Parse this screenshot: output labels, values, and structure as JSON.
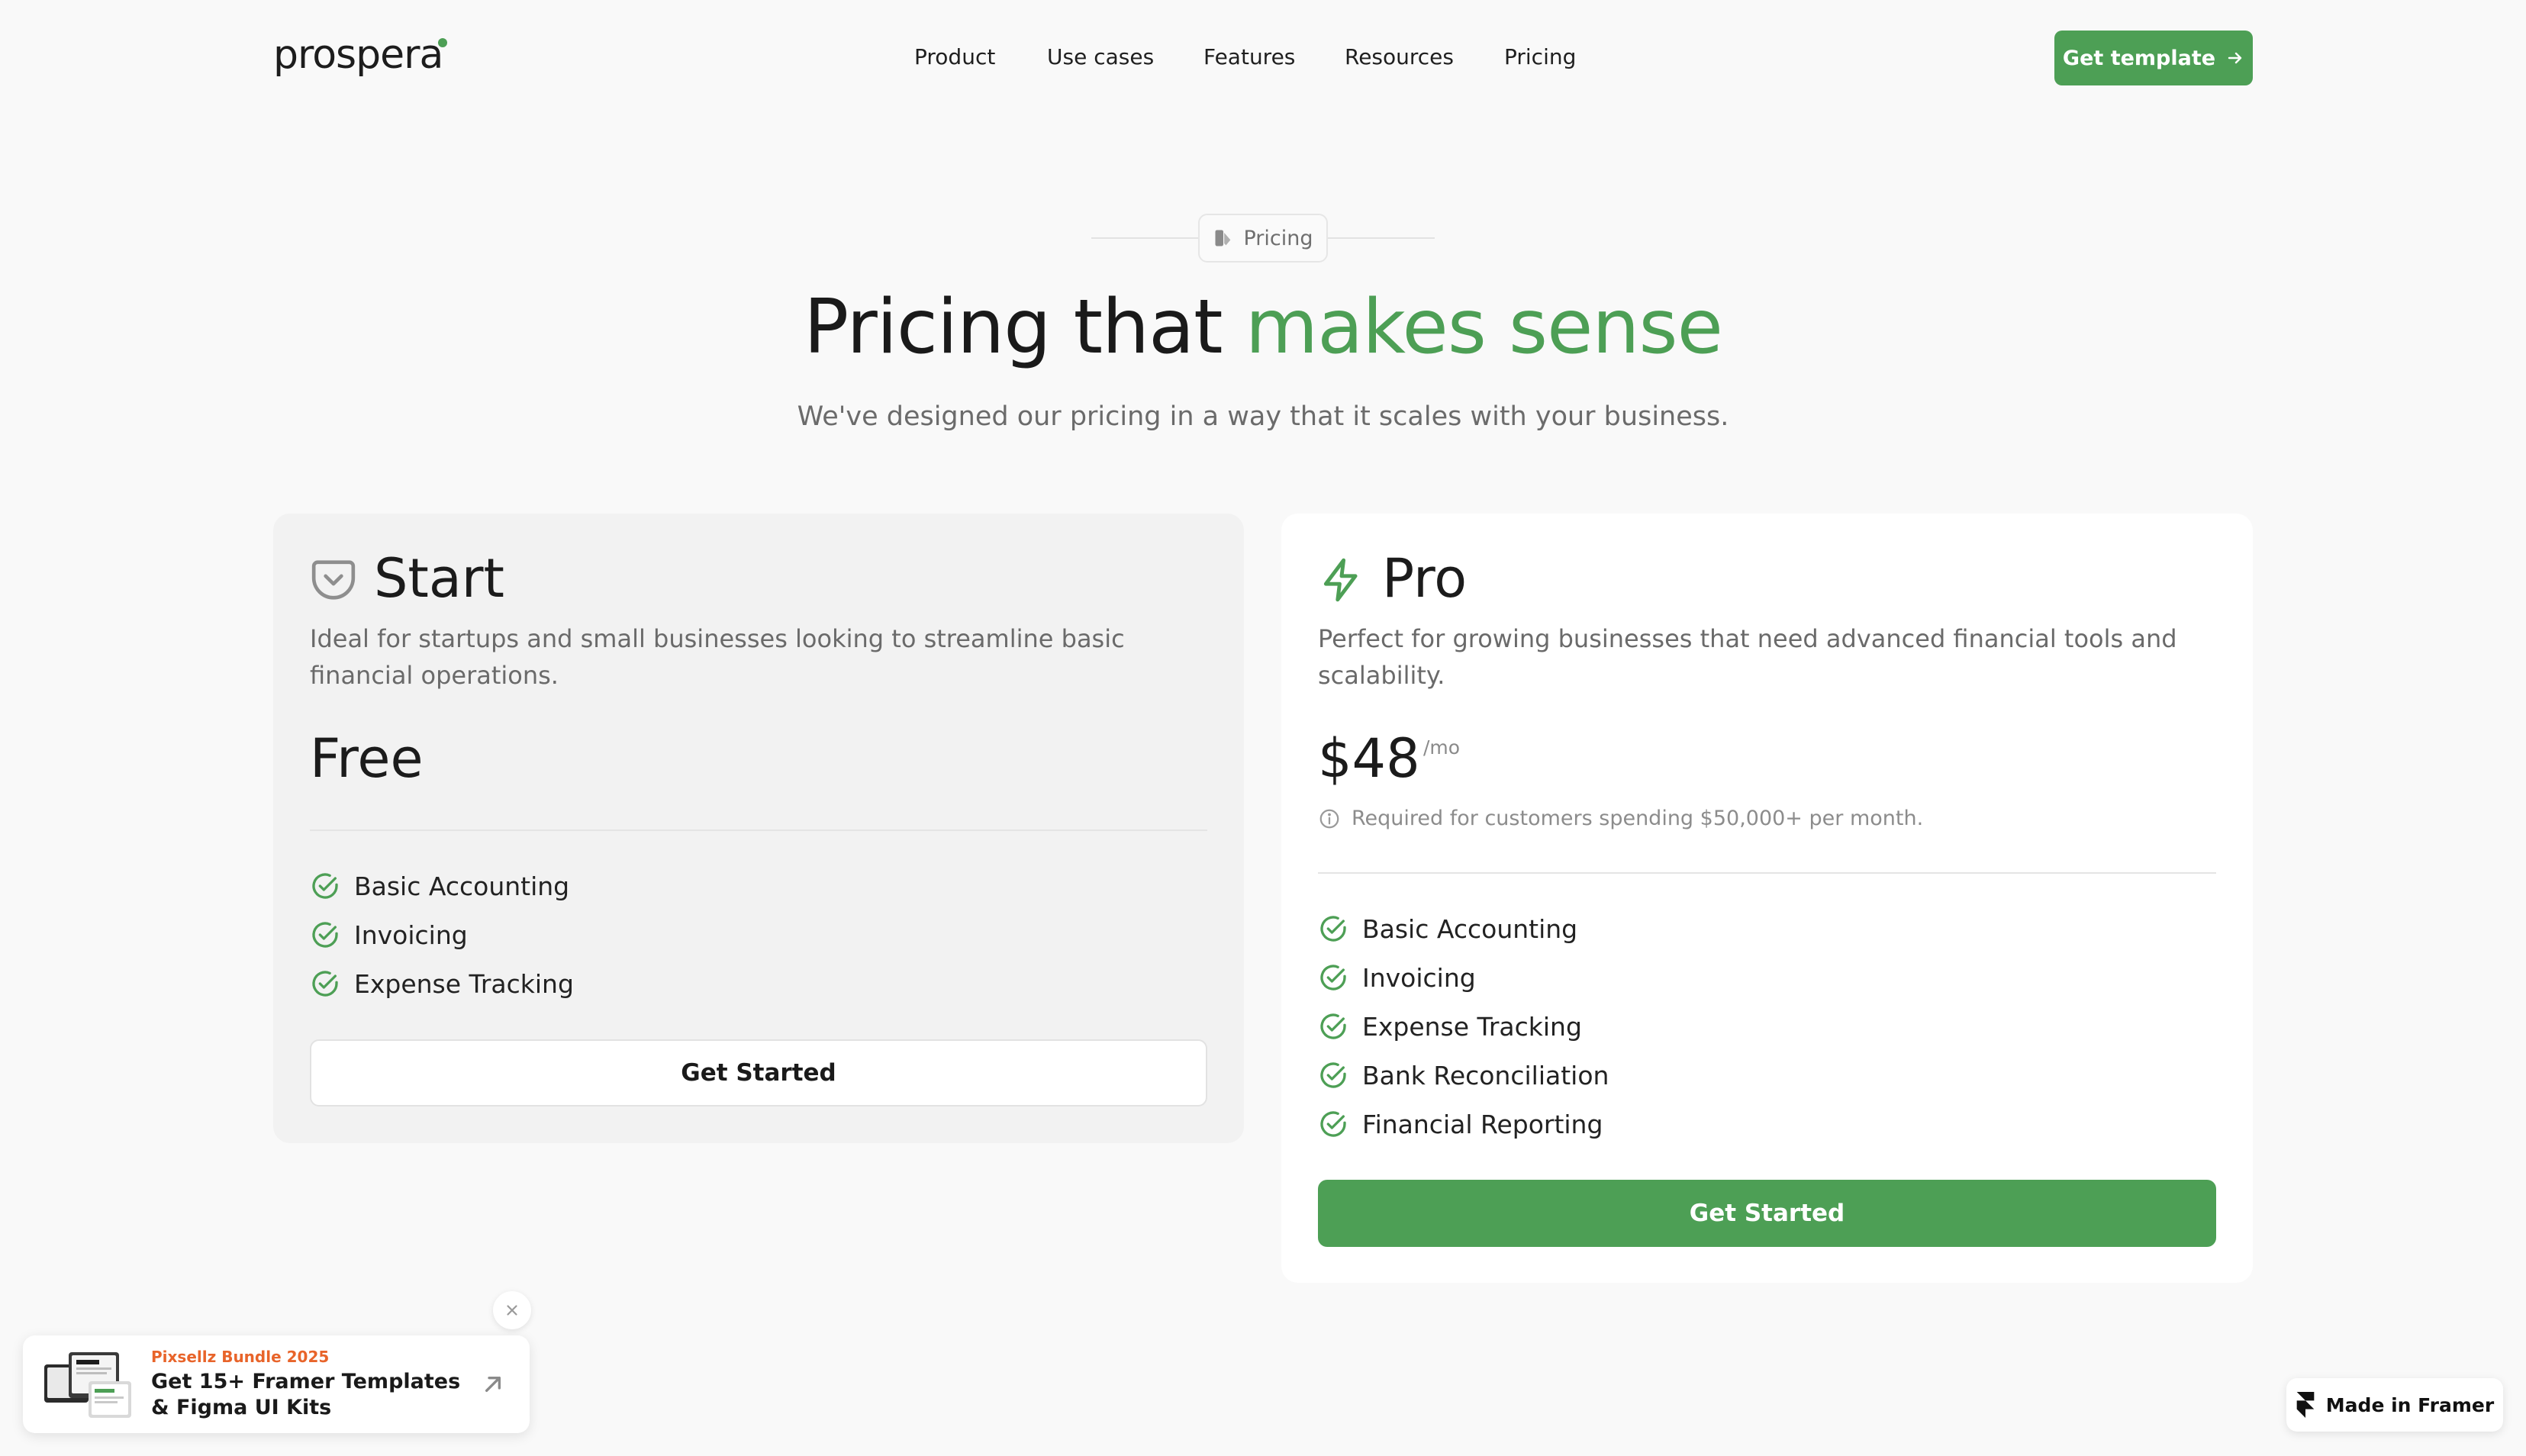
{
  "brand": {
    "logo_text": "prospera",
    "accent_color": "#4d9f55"
  },
  "nav": {
    "items": [
      {
        "label": "Product"
      },
      {
        "label": "Use cases"
      },
      {
        "label": "Features"
      },
      {
        "label": "Resources"
      },
      {
        "label": "Pricing"
      }
    ],
    "cta_label": "Get template",
    "cta_icon": "arrow-right-icon"
  },
  "header": {
    "eyebrow_label": "Pricing",
    "eyebrow_icon": "pricing-tag-icon",
    "title_main": "Pricing that ",
    "title_accent": "makes sense",
    "subtitle": "We've designed our pricing in a way that it scales with your business."
  },
  "plans": [
    {
      "name": "Start",
      "icon": "pocket-icon",
      "description": "Ideal for startups and small businesses looking to streamline basic financial operations.",
      "price": "Free",
      "features": [
        "Basic Accounting",
        "Invoicing",
        "Expense Tracking"
      ],
      "button_label": "Get Started"
    },
    {
      "name": "Pro",
      "icon": "lightning-icon",
      "description": "Perfect for growing businesses that need advanced financial tools and scalability.",
      "price": "$48",
      "price_unit": "/mo",
      "note": "Required for customers spending $50,000+ per month.",
      "note_icon": "info-icon",
      "features": [
        "Basic Accounting",
        "Invoicing",
        "Expense Tracking",
        "Bank Reconciliation",
        "Financial Reporting"
      ],
      "button_label": "Get Started"
    }
  ],
  "promo": {
    "tag": "Pixsellz Bundle 2025",
    "title": "Get 15+ Framer Templates & Figma UI Kits"
  },
  "badge": {
    "label": "Made in Framer"
  }
}
